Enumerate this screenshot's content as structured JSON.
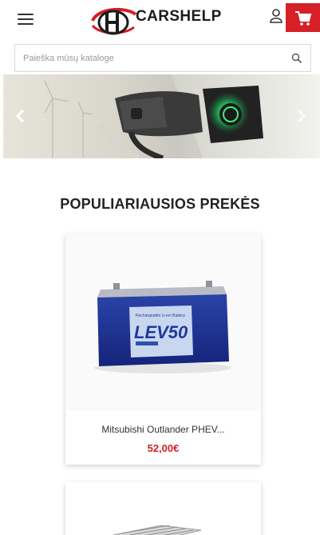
{
  "header": {
    "brand_name": "CARSHELP",
    "menu_icon": "hamburger-menu-icon",
    "user_icon": "user-icon",
    "cart_icon": "shopping-cart-icon",
    "accent_color": "#d61f26"
  },
  "search": {
    "placeholder": "Paieška mūsų kataloge",
    "icon": "search-icon"
  },
  "banner": {
    "prev_icon": "chevron-left-icon",
    "next_icon": "chevron-right-icon"
  },
  "section": {
    "title": "POPULIARIAUSIOS PREKĖS"
  },
  "products": [
    {
      "name": "Mitsubishi Outlander PHEV...",
      "price": "52,00€",
      "image_label": "LEV50"
    },
    {
      "name": "",
      "price": ""
    }
  ]
}
